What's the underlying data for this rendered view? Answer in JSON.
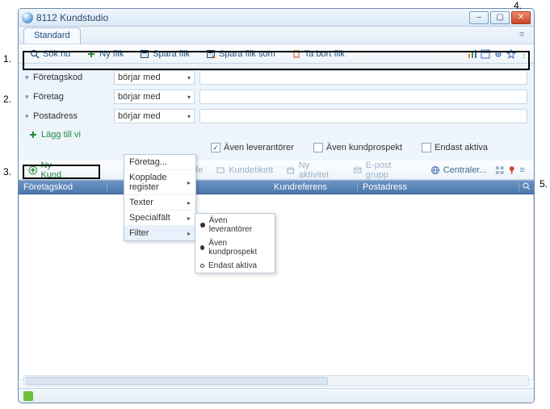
{
  "window": {
    "title": "8112 Kundstudio"
  },
  "tabs": [
    {
      "label": "Standard"
    }
  ],
  "toolbar": {
    "search": "Sök nu",
    "newtab": "Ny flik",
    "savetab": "Spara flik",
    "savetabas": "Spara flik som",
    "deltab": "Ta bort flik"
  },
  "search": {
    "rows": [
      {
        "label": "Företagskod",
        "op": "börjar med"
      },
      {
        "label": "Företag",
        "op": "börjar med"
      },
      {
        "label": "Postadress",
        "op": "börjar med"
      }
    ],
    "addCondition": "Lägg till vi",
    "checks": {
      "leverantorer": "Även leverantörer",
      "kundprospekt": "Även kundprospekt",
      "endastaktiva": "Endast aktiva"
    }
  },
  "toolbar2": {
    "nykund": "Ny Kund",
    "creditsafe": "editsafe",
    "kundetikett": "Kundetikett",
    "nyaktivitet": "Ny aktivitet",
    "epostgrupp": "E-post grupp",
    "centraler": "Centraler..."
  },
  "grid": {
    "cols": [
      "Företagskod",
      "",
      "Kundreferens",
      "Postadress"
    ]
  },
  "ctx": {
    "items": [
      "Företag...",
      "Kopplade register",
      "Texter",
      "Specialfält",
      "Filter"
    ],
    "filterSub": [
      "Även leverantörer",
      "Även kundprospekt",
      "Endast aktiva"
    ]
  },
  "annot": {
    "n1": "1.",
    "n2": "2.",
    "n3": "3.",
    "n4": "4.",
    "n5": "5."
  }
}
